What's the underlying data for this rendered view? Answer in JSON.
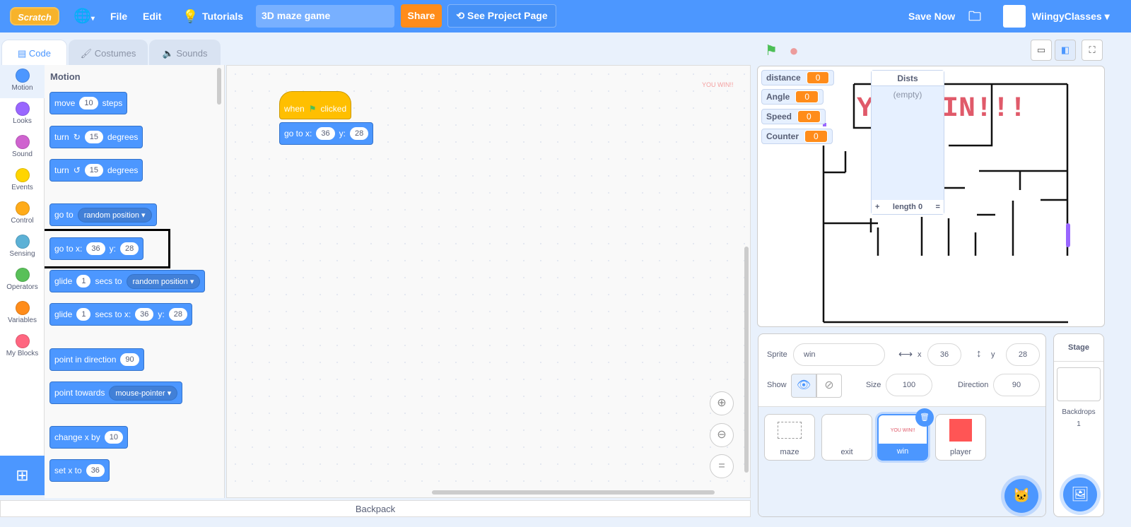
{
  "menubar": {
    "logo": "Scratch",
    "file": "File",
    "edit": "Edit",
    "tutorials": "Tutorials",
    "project_title": "3D maze game",
    "share": "Share",
    "see_project_page": "See Project Page",
    "save_now": "Save Now",
    "username": "WiingyClasses"
  },
  "tabs": [
    {
      "label": "Code"
    },
    {
      "label": "Costumes"
    },
    {
      "label": "Sounds"
    }
  ],
  "categories": [
    {
      "label": "Motion",
      "color": "#4c97ff"
    },
    {
      "label": "Looks",
      "color": "#9966ff"
    },
    {
      "label": "Sound",
      "color": "#cf63cf"
    },
    {
      "label": "Events",
      "color": "#ffd500"
    },
    {
      "label": "Control",
      "color": "#ffab19"
    },
    {
      "label": "Sensing",
      "color": "#5cb1d6"
    },
    {
      "label": "Operators",
      "color": "#59c059"
    },
    {
      "label": "Variables",
      "color": "#ff8c1a"
    },
    {
      "label": "My Blocks",
      "color": "#ff6680"
    }
  ],
  "palette": {
    "heading": "Motion",
    "blocks": {
      "move": {
        "a": "move",
        "v": "10",
        "b": "steps"
      },
      "turn_r": {
        "a": "turn",
        "v": "15",
        "b": "degrees"
      },
      "turn_l": {
        "a": "turn",
        "v": "15",
        "b": "degrees"
      },
      "goto": {
        "a": "go to",
        "dd": "random position"
      },
      "gotoxy": {
        "a": "go to x:",
        "x": "36",
        "b": "y:",
        "y": "28"
      },
      "glide": {
        "a": "glide",
        "v": "1",
        "b": "secs to",
        "dd": "random position"
      },
      "glidexy": {
        "a": "glide",
        "v": "1",
        "b": "secs to x:",
        "x": "36",
        "c": "y:",
        "y": "28"
      },
      "point": {
        "a": "point in direction",
        "v": "90"
      },
      "towards": {
        "a": "point towards",
        "dd": "mouse-pointer"
      },
      "changex": {
        "a": "change x by",
        "v": "10"
      },
      "setx": {
        "a": "set x to",
        "v": "36"
      }
    }
  },
  "script": {
    "hat_a": "when",
    "hat_b": "clicked",
    "goto_a": "go to x:",
    "x": "36",
    "goto_b": "y:",
    "y": "28",
    "watermark": "YOU WIN!!"
  },
  "backpack": "Backpack",
  "stage": {
    "monitors": [
      {
        "name": "distance",
        "value": "0"
      },
      {
        "name": "Angle",
        "value": "0"
      },
      {
        "name": "Speed",
        "value": "0"
      },
      {
        "name": "Counter",
        "value": "0"
      }
    ],
    "list": {
      "title": "Dists",
      "empty": "(empty)",
      "add": "+",
      "length": "length 0",
      "resize": "="
    },
    "win_text": "YOU WIN!!!"
  },
  "sprite_info": {
    "sprite_label": "Sprite",
    "sprite_name": "win",
    "x_label": "x",
    "x": "36",
    "y_label": "y",
    "y": "28",
    "show_label": "Show",
    "size_label": "Size",
    "size": "100",
    "direction_label": "Direction",
    "direction": "90"
  },
  "sprites": [
    {
      "name": "maze"
    },
    {
      "name": "exit"
    },
    {
      "name": "win",
      "thumb": "YOU WIN!!"
    },
    {
      "name": "player"
    }
  ],
  "stage_panel": {
    "title": "Stage",
    "backdrops_label": "Backdrops",
    "backdrops": "1"
  }
}
